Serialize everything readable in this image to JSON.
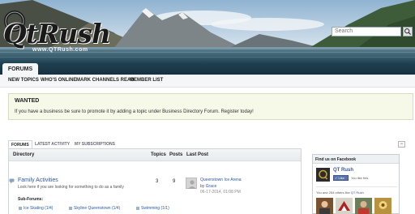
{
  "branding": {
    "logo_text": "QtRush",
    "logo_url": "www.QTRush.com"
  },
  "search": {
    "placeholder": "Search",
    "button_icon": "search-icon"
  },
  "nav": {
    "active_tab": "FORUMS",
    "subnav": [
      "NEW TOPICS",
      "WHO'S ONLINE",
      "MARK CHANNELS READ",
      "MEMBER LIST"
    ]
  },
  "notice": {
    "title": "WANTED",
    "text": "If you have a business be sure to promote it by adding a topic under Business Directory Forum. Register today!"
  },
  "forum_tabs": [
    "FORUMS",
    "LATEST ACTIVITY",
    "MY SUBSCRIPTIONS"
  ],
  "forum_table": {
    "headers": {
      "directory": "Directory",
      "topics": "Topics",
      "posts": "Posts",
      "last_post": "Last Post"
    },
    "row": {
      "title": "Family Activities",
      "description": "Look here if you are looking for something to do as a family",
      "topics": "3",
      "posts": "9",
      "last_post_title": "Queenstown Ice Arena",
      "last_post_by_prefix": "by",
      "last_post_author": "Grace",
      "last_post_date": "06-17-2014, 01:08 PM",
      "subforums_label": "Sub-Forums:",
      "subforums": [
        "Ice Skating (1/4)",
        "Skyline Queenstown (1/4)",
        "Swimming (1/1)"
      ]
    }
  },
  "sidebar": {
    "collapse_symbol": "−",
    "facebook": {
      "heading": "Find us on Facebook",
      "page_name": "QT Rush",
      "like_label": "Like",
      "like_text": "You like this.",
      "count_prefix": "You and 254 others like",
      "count_link": "QT Rush"
    }
  },
  "colors": {
    "link": "#2a58a6",
    "nav_dark": "#1f3f50",
    "notice_bg": "#f6f8e8",
    "facebook_blue": "#3b5998"
  }
}
